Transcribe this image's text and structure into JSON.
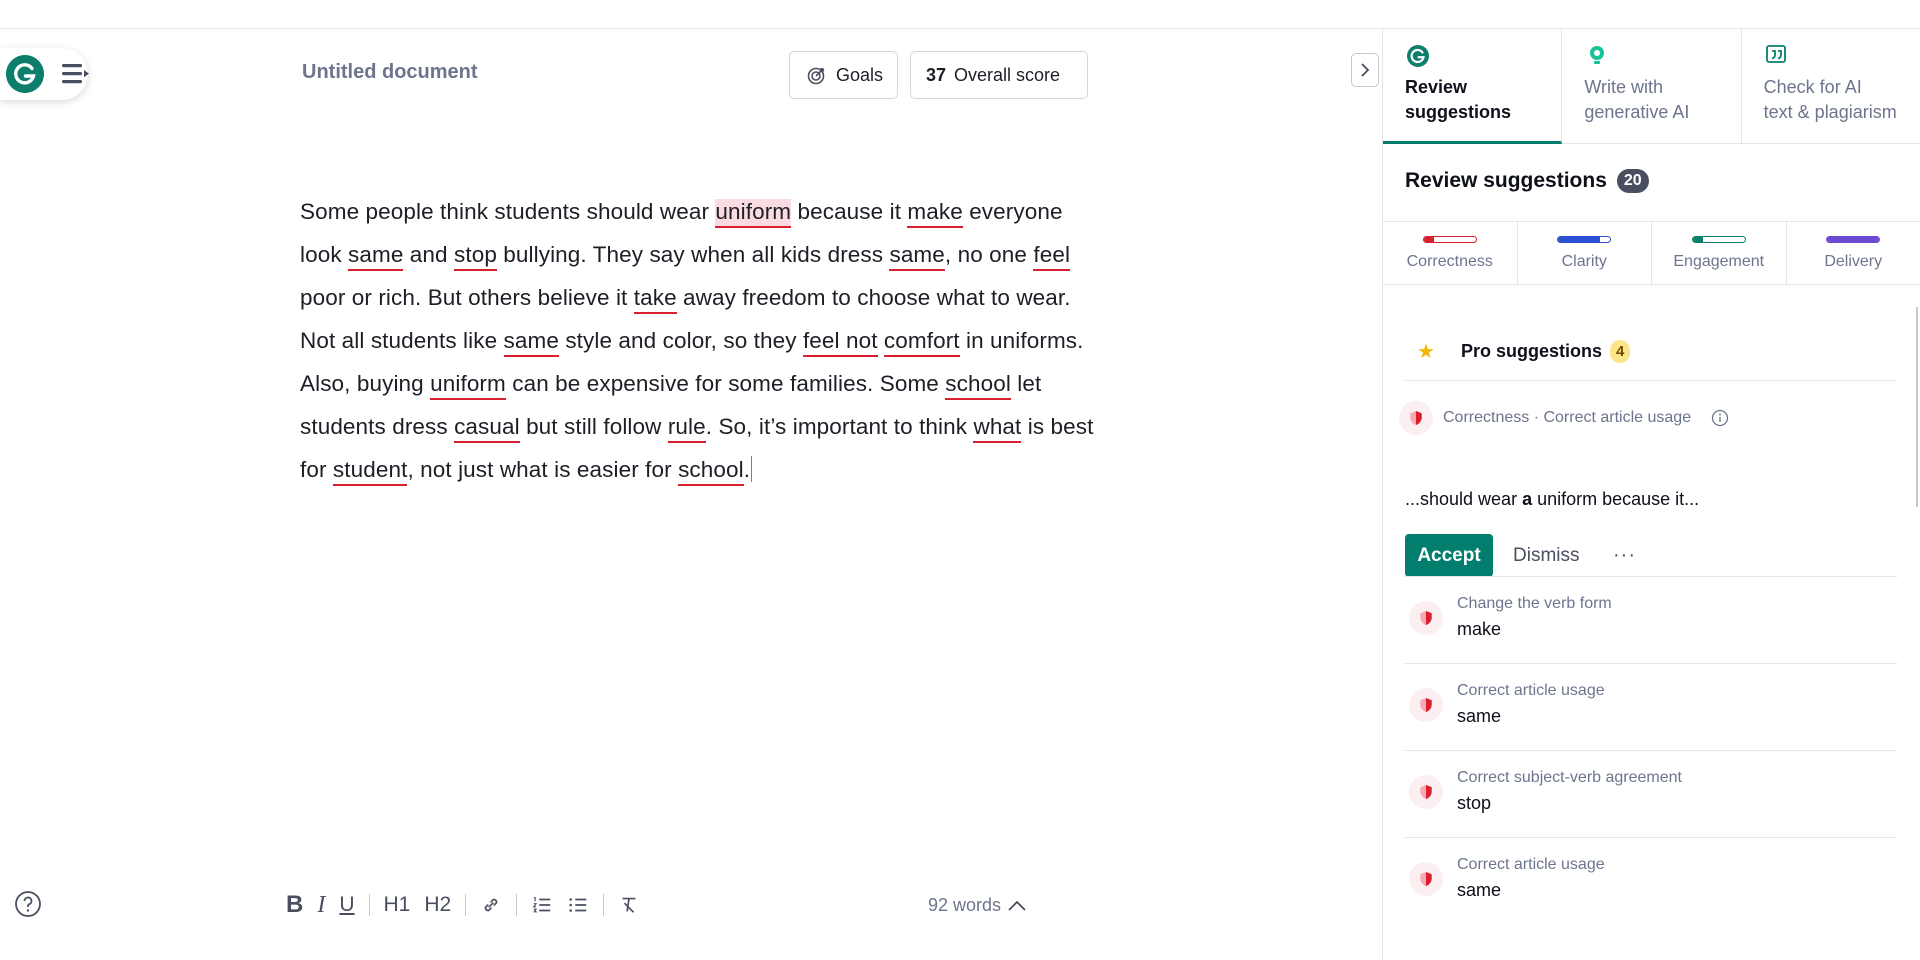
{
  "document": {
    "title": "Untitled document",
    "goals_label": "Goals",
    "score_value": "37",
    "score_label": "Overall score",
    "text_segments": [
      {
        "t": "Some people think students should wear ",
        "s": ""
      },
      {
        "t": "uniform",
        "s": "err err-active"
      },
      {
        "t": " because it ",
        "s": ""
      },
      {
        "t": "make",
        "s": "err"
      },
      {
        "t": " everyone look ",
        "s": ""
      },
      {
        "t": "same",
        "s": "err"
      },
      {
        "t": " and ",
        "s": ""
      },
      {
        "t": "stop",
        "s": "err"
      },
      {
        "t": " bullying. They say when all kids dress ",
        "s": ""
      },
      {
        "t": "same",
        "s": "err"
      },
      {
        "t": ", no one ",
        "s": ""
      },
      {
        "t": "feel",
        "s": "err"
      },
      {
        "t": " poor or rich. But others believe it ",
        "s": ""
      },
      {
        "t": "take",
        "s": "err"
      },
      {
        "t": " away freedom to choose what to wear. Not all students like ",
        "s": ""
      },
      {
        "t": "same",
        "s": "err"
      },
      {
        "t": " style and color, so they ",
        "s": ""
      },
      {
        "t": "feel not",
        "s": "err"
      },
      {
        "t": " ",
        "s": ""
      },
      {
        "t": "comfort",
        "s": "err"
      },
      {
        "t": " in uniforms. Also, buying ",
        "s": ""
      },
      {
        "t": "uniform",
        "s": "err"
      },
      {
        "t": " can be expensive for some families. Some ",
        "s": ""
      },
      {
        "t": "school",
        "s": "err"
      },
      {
        "t": " let students dress ",
        "s": ""
      },
      {
        "t": "casual",
        "s": "err"
      },
      {
        "t": " but still follow ",
        "s": ""
      },
      {
        "t": "rule",
        "s": "err"
      },
      {
        "t": ". So, it’s important to think ",
        "s": ""
      },
      {
        "t": "what",
        "s": "err"
      },
      {
        "t": " is best for ",
        "s": ""
      },
      {
        "t": "student",
        "s": "err"
      },
      {
        "t": ", not just what is easier for ",
        "s": ""
      },
      {
        "t": "school",
        "s": "err"
      },
      {
        "t": ".",
        "s": ""
      }
    ]
  },
  "toolbar": {
    "bold": "B",
    "italic": "I",
    "underline": "U",
    "h1": "H1",
    "h2": "H2",
    "word_count": "92 words"
  },
  "panel": {
    "tabs": [
      {
        "label_line1": "Review",
        "label_line2": "suggestions",
        "icon": "grammarly-g-icon"
      },
      {
        "label_line1": "Write with",
        "label_line2": "generative AI",
        "icon": "lightbulb-icon"
      },
      {
        "label_line1": "Check for AI",
        "label_line2": "text & plagiarism",
        "icon": "quote-icon"
      }
    ],
    "heading": "Review suggestions",
    "heading_count": "20",
    "categories": [
      {
        "label": "Correctness",
        "color": "#d8202f",
        "fill": 0.2
      },
      {
        "label": "Clarity",
        "color": "#2b50d1",
        "fill": 0.8
      },
      {
        "label": "Engagement",
        "color": "#0d7e6b",
        "fill": 0.2
      },
      {
        "label": "Delivery",
        "color": "#6b49d1",
        "fill": 1.0
      }
    ],
    "pro_label": "Pro suggestions",
    "pro_count": "4",
    "active_card": {
      "header": "Correctness · Correct article usage",
      "context_before": "...should wear ",
      "context_insert": "a",
      "context_after": " uniform because it...",
      "accept_label": "Accept",
      "dismiss_label": "Dismiss",
      "more_label": "···"
    },
    "suggestions": [
      {
        "type": "Change the verb form",
        "word": "make"
      },
      {
        "type": "Correct article usage",
        "word": "same"
      },
      {
        "type": "Correct subject-verb agreement",
        "word": "stop"
      },
      {
        "type": "Correct article usage",
        "word": "same"
      }
    ]
  },
  "colors": {
    "accent_green": "#027e6f",
    "error_red": "#d8202f",
    "grammarly_green": "#15c39a"
  }
}
